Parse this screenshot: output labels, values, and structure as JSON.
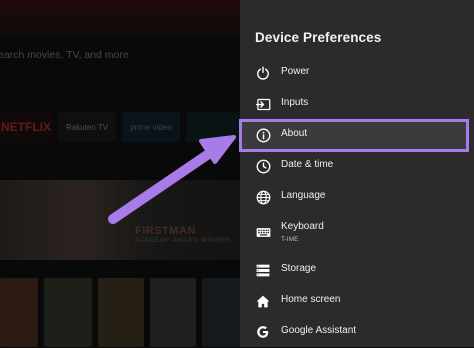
{
  "background": {
    "search_hint": "earch movies, TV, and more",
    "apps": [
      "NETFLIX",
      "Rakuten TV",
      "prime video",
      ""
    ],
    "banner_title": "FIRSTMAN",
    "banner_subtitle": "ACADEMY AWARD WINNER"
  },
  "panel": {
    "title": "Device Preferences",
    "items": [
      {
        "label": "Power",
        "icon": "power-icon"
      },
      {
        "label": "Inputs",
        "icon": "input-icon"
      },
      {
        "label": "About",
        "icon": "info-icon",
        "selected": true
      },
      {
        "label": "Date & time",
        "icon": "clock-icon"
      },
      {
        "label": "Language",
        "icon": "globe-icon"
      },
      {
        "label": "Keyboard",
        "sublabel": "T-IME",
        "icon": "keyboard-icon"
      },
      {
        "label": "Storage",
        "icon": "storage-icon"
      },
      {
        "label": "Home screen",
        "icon": "home-icon"
      },
      {
        "label": "Google Assistant",
        "icon": "google-icon"
      }
    ]
  },
  "colors": {
    "accent": "#a77ce8",
    "panel": "#2b2b2d",
    "netflix": "#7a2a2a"
  }
}
